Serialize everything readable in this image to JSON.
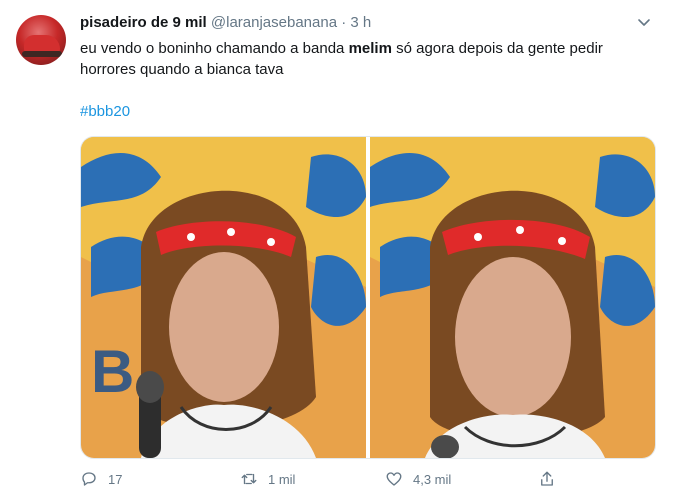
{
  "tweet": {
    "display_name": "pisadeiro de 9 mil",
    "handle": "@laranjasebanana",
    "separator": "·",
    "time": "3 h",
    "text_part1": "eu vendo o boninho chamando a banda ",
    "text_bold": "melim",
    "text_part2": " só agora depois da gente pedir horrores quando a bianca tava",
    "hashtag": "#bbb20"
  },
  "media": {
    "images": [
      {
        "icon": "photo-left"
      },
      {
        "icon": "photo-right"
      }
    ]
  },
  "actions": {
    "reply": {
      "icon": "reply-icon",
      "count": "17"
    },
    "retweet": {
      "icon": "retweet-icon",
      "count": "1 mil"
    },
    "like": {
      "icon": "heart-icon",
      "count": "4,3 mil"
    },
    "share": {
      "icon": "share-icon"
    }
  },
  "colors": {
    "link": "#1b95e0",
    "secondary_text": "#657786",
    "primary_text": "#14171a",
    "border": "#e1e8ed"
  }
}
